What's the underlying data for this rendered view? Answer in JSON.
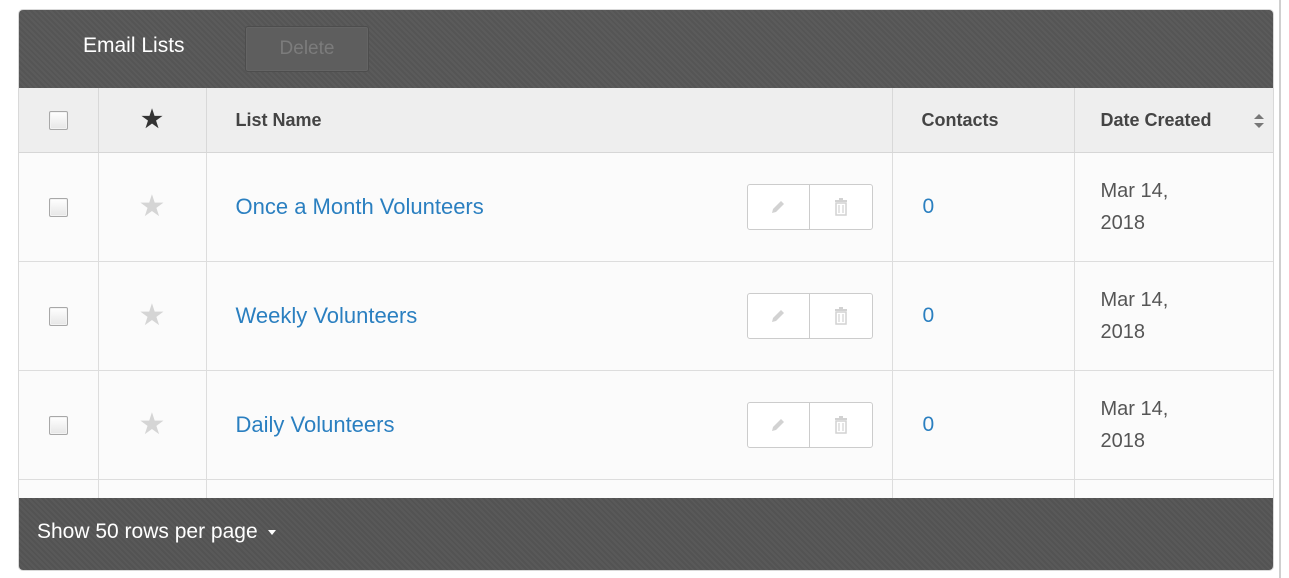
{
  "toolbar": {
    "title": "Email Lists",
    "delete_label": "Delete"
  },
  "table": {
    "columns": {
      "select_all": "",
      "favorite": "star-icon",
      "list_name": "List Name",
      "contacts": "Contacts",
      "date_created": "Date Created"
    },
    "rows": [
      {
        "name": "Once a Month Volunteers",
        "contacts": "0",
        "date_line1": "Mar 14,",
        "date_line2": "2018"
      },
      {
        "name": "Weekly Volunteers",
        "contacts": "0",
        "date_line1": "Mar 14,",
        "date_line2": "2018"
      },
      {
        "name": "Daily Volunteers",
        "contacts": "0",
        "date_line1": "Mar 14,",
        "date_line2": "2018"
      }
    ],
    "row_actions": [
      "pencil-icon",
      "trash-icon"
    ]
  },
  "footer": {
    "rows_per_page_label": "Show 50 rows per page"
  },
  "colors": {
    "toolbar_bg": "#575757",
    "link": "#2a7fc0",
    "header_bg": "#eeeeee"
  }
}
